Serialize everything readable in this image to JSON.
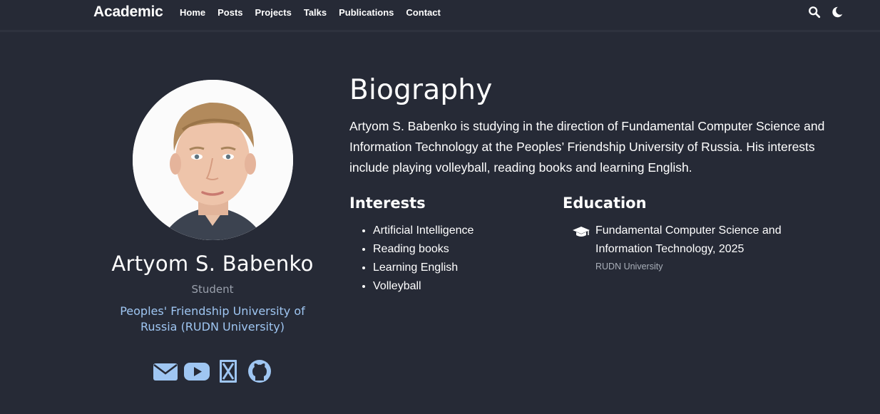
{
  "nav": {
    "brand": "Academic",
    "links": [
      "Home",
      "Posts",
      "Projects",
      "Talks",
      "Publications",
      "Contact"
    ],
    "icons": [
      "search-icon",
      "moon-icon"
    ]
  },
  "profile": {
    "name": "Artyom S. Babenko",
    "role": "Student",
    "organization": "Peoples' Friendship University of Russia (RUDN University)",
    "social_icons": [
      "envelope-icon",
      "youtube-icon",
      "x-icon",
      "github-icon"
    ]
  },
  "biography": {
    "title": "Biography",
    "text": "Artyom S. Babenko is studying in the direction of Fundamental Computer Science and Information Technology at the Peoples’ Friendship University of Russia. His interests include playing volleyball, reading books and learning English."
  },
  "interests": {
    "title": "Interests",
    "items": [
      "Artificial Intelligence",
      "Reading books",
      "Learning English",
      "Volleyball"
    ]
  },
  "education": {
    "title": "Education",
    "items": [
      {
        "course": "Fundamental Computer Science and Information Technology, 2025",
        "institution": "RUDN University",
        "icon": "graduation-cap-icon"
      }
    ]
  },
  "colors": {
    "background": "#262a36",
    "link": "#9fc6f2",
    "muted": "#9aa0ac"
  }
}
